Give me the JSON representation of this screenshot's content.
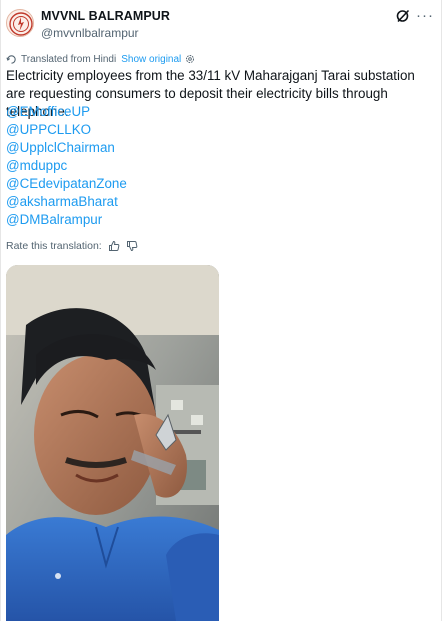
{
  "author": {
    "display_name": "MVVNL BALRAMPUR",
    "handle": "@mvvnlbalrampur",
    "avatar_icon": "mvvnl-logo-icon",
    "grok_icon": "grok-icon",
    "more_icon": "more-horizontal-icon",
    "more_glyph": "···"
  },
  "translation": {
    "label": "Translated from Hindi",
    "show_original": "Show original",
    "settings_icon": "gear-icon",
    "rate_label": "Rate this translation:",
    "thumbs_up_icon": "thumbs-up-icon",
    "thumbs_down_icon": "thumbs-down-icon"
  },
  "tweet": {
    "text": "Electricity employees from the 33/11 kV Maharajganj Tarai substation are requesting consumers to deposit their electricity bills through telephone.",
    "mentions": [
      "@EMofficeUP",
      "@UPPCLLKO",
      "@UpplclChairman",
      "@mduppc",
      "@CEdevipatanZone",
      "@aksharmaBharat",
      "@DMBalrampur"
    ]
  },
  "media": {
    "type": "video",
    "description_icon": "video-thumbnail"
  },
  "colors": {
    "link": "#1d9bf0",
    "text": "#0f1419",
    "muted": "#536471",
    "shirt": "#2f6fc9"
  }
}
